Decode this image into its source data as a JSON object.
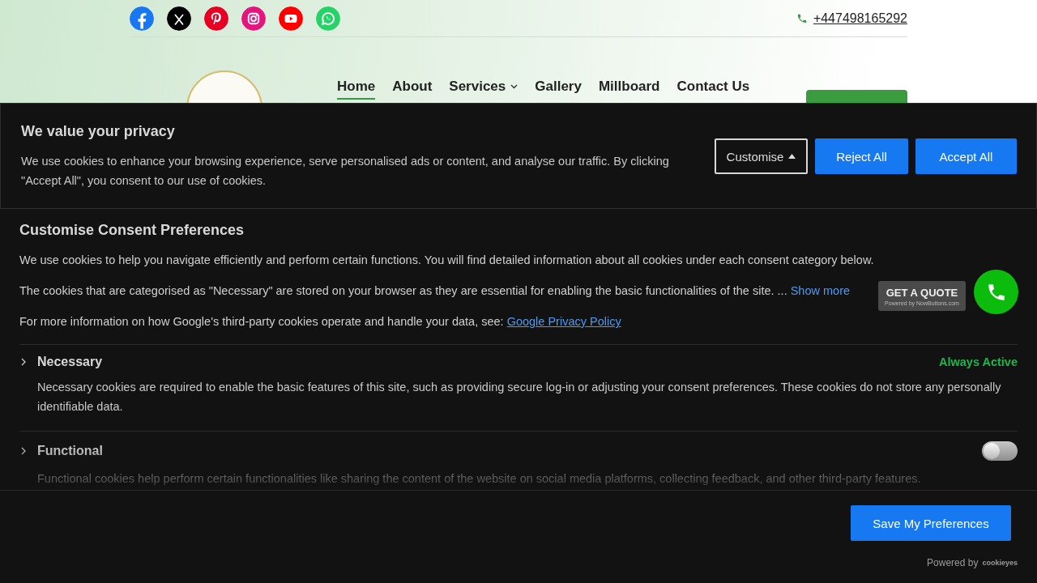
{
  "header": {
    "social_links": [
      {
        "kind": "facebook"
      },
      {
        "kind": "x"
      },
      {
        "kind": "pinterest"
      },
      {
        "kind": "instagram"
      },
      {
        "kind": "youtube"
      },
      {
        "kind": "whatsapp"
      }
    ],
    "phone": "+447498165292",
    "nav": [
      {
        "label": "Home",
        "selected": true,
        "dropdown": false
      },
      {
        "label": "About",
        "selected": false,
        "dropdown": false
      },
      {
        "label": "Services",
        "selected": false,
        "dropdown": true
      },
      {
        "label": "Gallery",
        "selected": false,
        "dropdown": false
      },
      {
        "label": "Millboard",
        "selected": false,
        "dropdown": false
      },
      {
        "label": "Contact Us",
        "selected": false,
        "dropdown": false
      }
    ]
  },
  "banner": {
    "title": "We value your privacy",
    "text": "We use cookies to enhance your browsing experience, serve personalised ads or content, and analyse our traffic. By clicking \"Accept All\", you consent to our use of cookies.",
    "customise": {
      "label": "Customise",
      "expanded": true
    },
    "buttons": [
      "Reject All",
      "Accept All"
    ]
  },
  "preferences": {
    "title": "Customise Consent Preferences",
    "intro": "We use cookies to help you navigate efficiently and perform certain functions. You will find detailed information about all cookies under each consent category below.",
    "necessary_note": "The cookies that are categorised as \"Necessary\" are stored on your browser as they are essential for enabling the basic functionalities of the site. ...",
    "show_more": "Show more",
    "google_note": "For more information on how Google's third-party cookies operate and handle your data, see:",
    "google_link": "Google Privacy Policy",
    "categories": [
      {
        "name": "Necessary",
        "kind": "always_active",
        "status": "Always Active",
        "description": "Necessary cookies are required to enable the basic features of this site, such as providing secure log-in or adjusting your consent preferences. These cookies do not store any personally identifiable data."
      },
      {
        "name": "Functional",
        "kind": "toggle",
        "on": false,
        "description": "Functional cookies help perform certain functionalities like sharing the content of the website on social media platforms, collecting feedback, and other third-party features."
      }
    ]
  },
  "quote_widget": {
    "label": "GET A QUOTE",
    "sub": "Powered by NowButtons.com"
  },
  "footer": {
    "save": "Save My Preferences",
    "powered_by": "Powered by",
    "brand": "cookieyes"
  }
}
